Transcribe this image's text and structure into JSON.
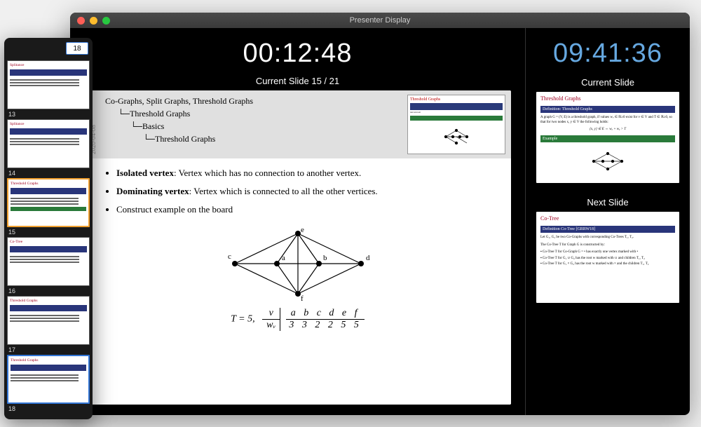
{
  "window": {
    "title": "Presenter Display"
  },
  "navigator": {
    "page_input_value": "18",
    "thumbs": [
      {
        "num": "13",
        "title": "Splitance"
      },
      {
        "num": "14",
        "title": "Splitance"
      },
      {
        "num": "15",
        "title": "Threshold Graphs",
        "current": true
      },
      {
        "num": "16",
        "title": "Co-Tree"
      },
      {
        "num": "17",
        "title": "Threshold Graphs"
      },
      {
        "num": "18",
        "title": "Threshold Graphs",
        "selected": true
      }
    ]
  },
  "main": {
    "timer": "00:12:48",
    "clock": "09:41:36",
    "current_label": "Current Slide 15 / 21",
    "current_mini_label": "Current Slide",
    "next_label": "Next Slide",
    "breadcrumb": {
      "date": "2020-04-08",
      "l0": "Co-Graphs, Split Graphs, Threshold Graphs",
      "l1": "Threshold Graphs",
      "l2": "Basics",
      "l3": "Threshold Graphs"
    },
    "bullets": [
      {
        "strong": "Isolated vertex",
        "text": ": Vertex which has no connection to another vertex."
      },
      {
        "strong": "Dominating vertex",
        "text": ": Vertex which is connected to all the other vertices."
      },
      {
        "strong": "",
        "text": "Construct example on the board"
      }
    ],
    "graph_labels": {
      "a": "a",
      "b": "b",
      "c": "c",
      "d": "d",
      "e": "e",
      "f": "f"
    },
    "table": {
      "prefix": "T = 5,",
      "rh1": "v",
      "rh2": "wᵥ",
      "cols": [
        "a",
        "b",
        "c",
        "d",
        "e",
        "f"
      ],
      "vals": [
        "3",
        "3",
        "2",
        "2",
        "5",
        "5"
      ]
    }
  },
  "right": {
    "current": {
      "title": "Threshold Graphs",
      "bar": "Definition: Threshold Graphs",
      "body": "A graph G = (V, E) is a threshold graph, if values wᵥ ∈ ℝ≥0 exist for v ∈ V and T ∈ ℝ≥0, so that for two nodes x, y ∈ V the following holds:",
      "formula": "{x, y} ∈ E ⇔ wₓ + wᵧ > T",
      "example": "Example"
    },
    "next": {
      "title": "Co-Tree",
      "bar": "Definition Co-Tree [GRRW18]",
      "body": "Let G₁, G₂ be two Co-Graphs with corresponding Co-Trees T₁, T₂.",
      "line": "The Co-Tree T for Graph G is constructed by:",
      "items": [
        "Co-Tree T for Co-Graph G = • has exactly one vertex marked with •",
        "Co-Tree T for G₁ ∪ G₂ has the root w marked with ∪ and children T₁, T₂",
        "Co-Tree T for G₁ × G₂ has the root w marked with × and the children T₁, T₂"
      ]
    }
  }
}
